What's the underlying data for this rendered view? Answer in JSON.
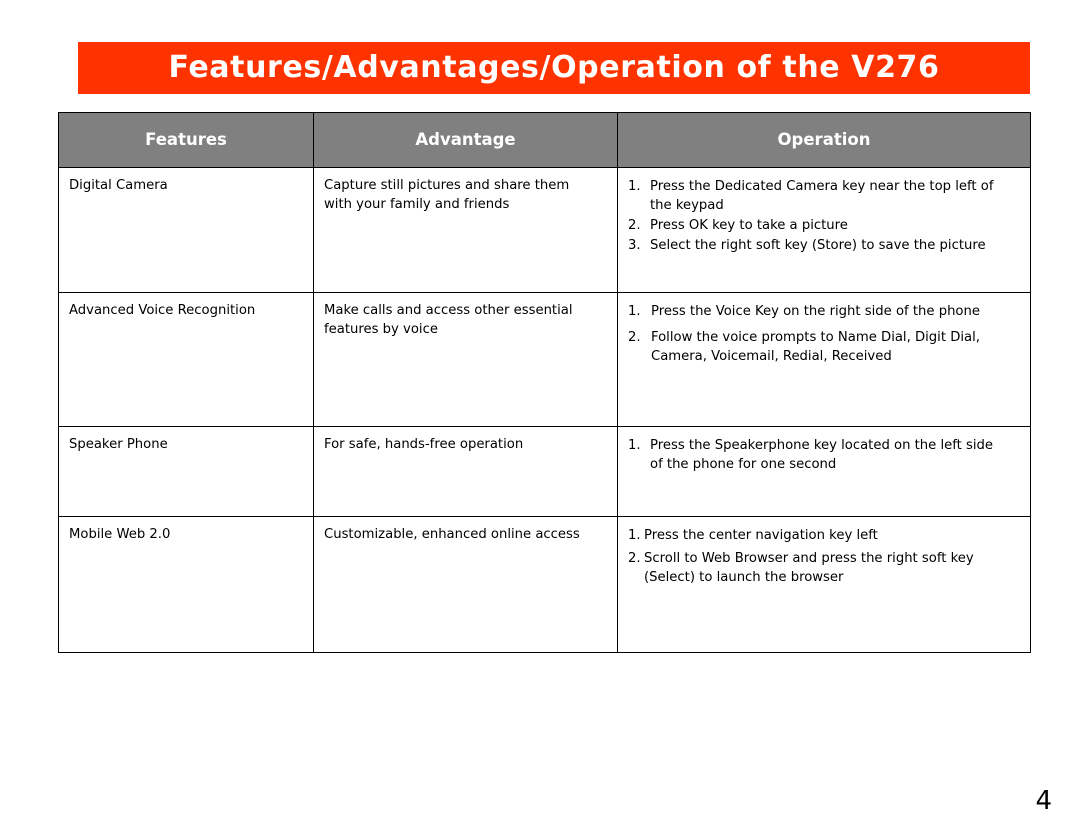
{
  "slide": {
    "title": "Features/Advantages/Operation of the V276",
    "page_number": "4",
    "banner_color": "#FF3300",
    "header_row_color": "#808080",
    "title_text_color": "#FFFFFF",
    "body_text_color": "#000000"
  },
  "table": {
    "columns": [
      {
        "key": "features",
        "label": "Features"
      },
      {
        "key": "advantage",
        "label": "Advantage"
      },
      {
        "key": "operation",
        "label": "Operation"
      }
    ],
    "rows": [
      {
        "feature": "Digital Camera",
        "advantage": "Capture still pictures and share them\nwith your family and friends",
        "operation_steps": [
          {
            "num": "1.",
            "text": "Press the Dedicated Camera key near the top left of\n the keypad"
          },
          {
            "num": "2.",
            "text": "Press OK key to take a picture"
          },
          {
            "num": "3.",
            "text": "Select the right soft key (Store) to save the picture"
          }
        ]
      },
      {
        "feature": "Advanced Voice Recognition",
        "advantage": "Make calls and access other essential\nfeatures by voice",
        "operation_steps": [
          {
            "num": "1.",
            "text": "Press the Voice Key on the right  side of the phone"
          },
          {
            "num": "2.",
            "text": "Follow the voice prompts to Name Dial, Digit Dial,\nCamera, Voicemail, Redial, Received"
          }
        ]
      },
      {
        "feature": "Speaker Phone",
        "advantage": "For safe, hands-free operation",
        "operation_steps": [
          {
            "num": "1.",
            "text": "Press the Speakerphone key located on the left side\n of the phone for one second"
          }
        ]
      },
      {
        "feature": "Mobile Web 2.0",
        "advantage": "Customizable, enhanced online access",
        "operation_steps": [
          {
            "num": "1.",
            "text": "Press the center navigation key left"
          },
          {
            "num": "2.",
            "text": "Scroll to Web Browser and press the right soft key\n (Select) to launch the browser"
          }
        ]
      }
    ]
  }
}
